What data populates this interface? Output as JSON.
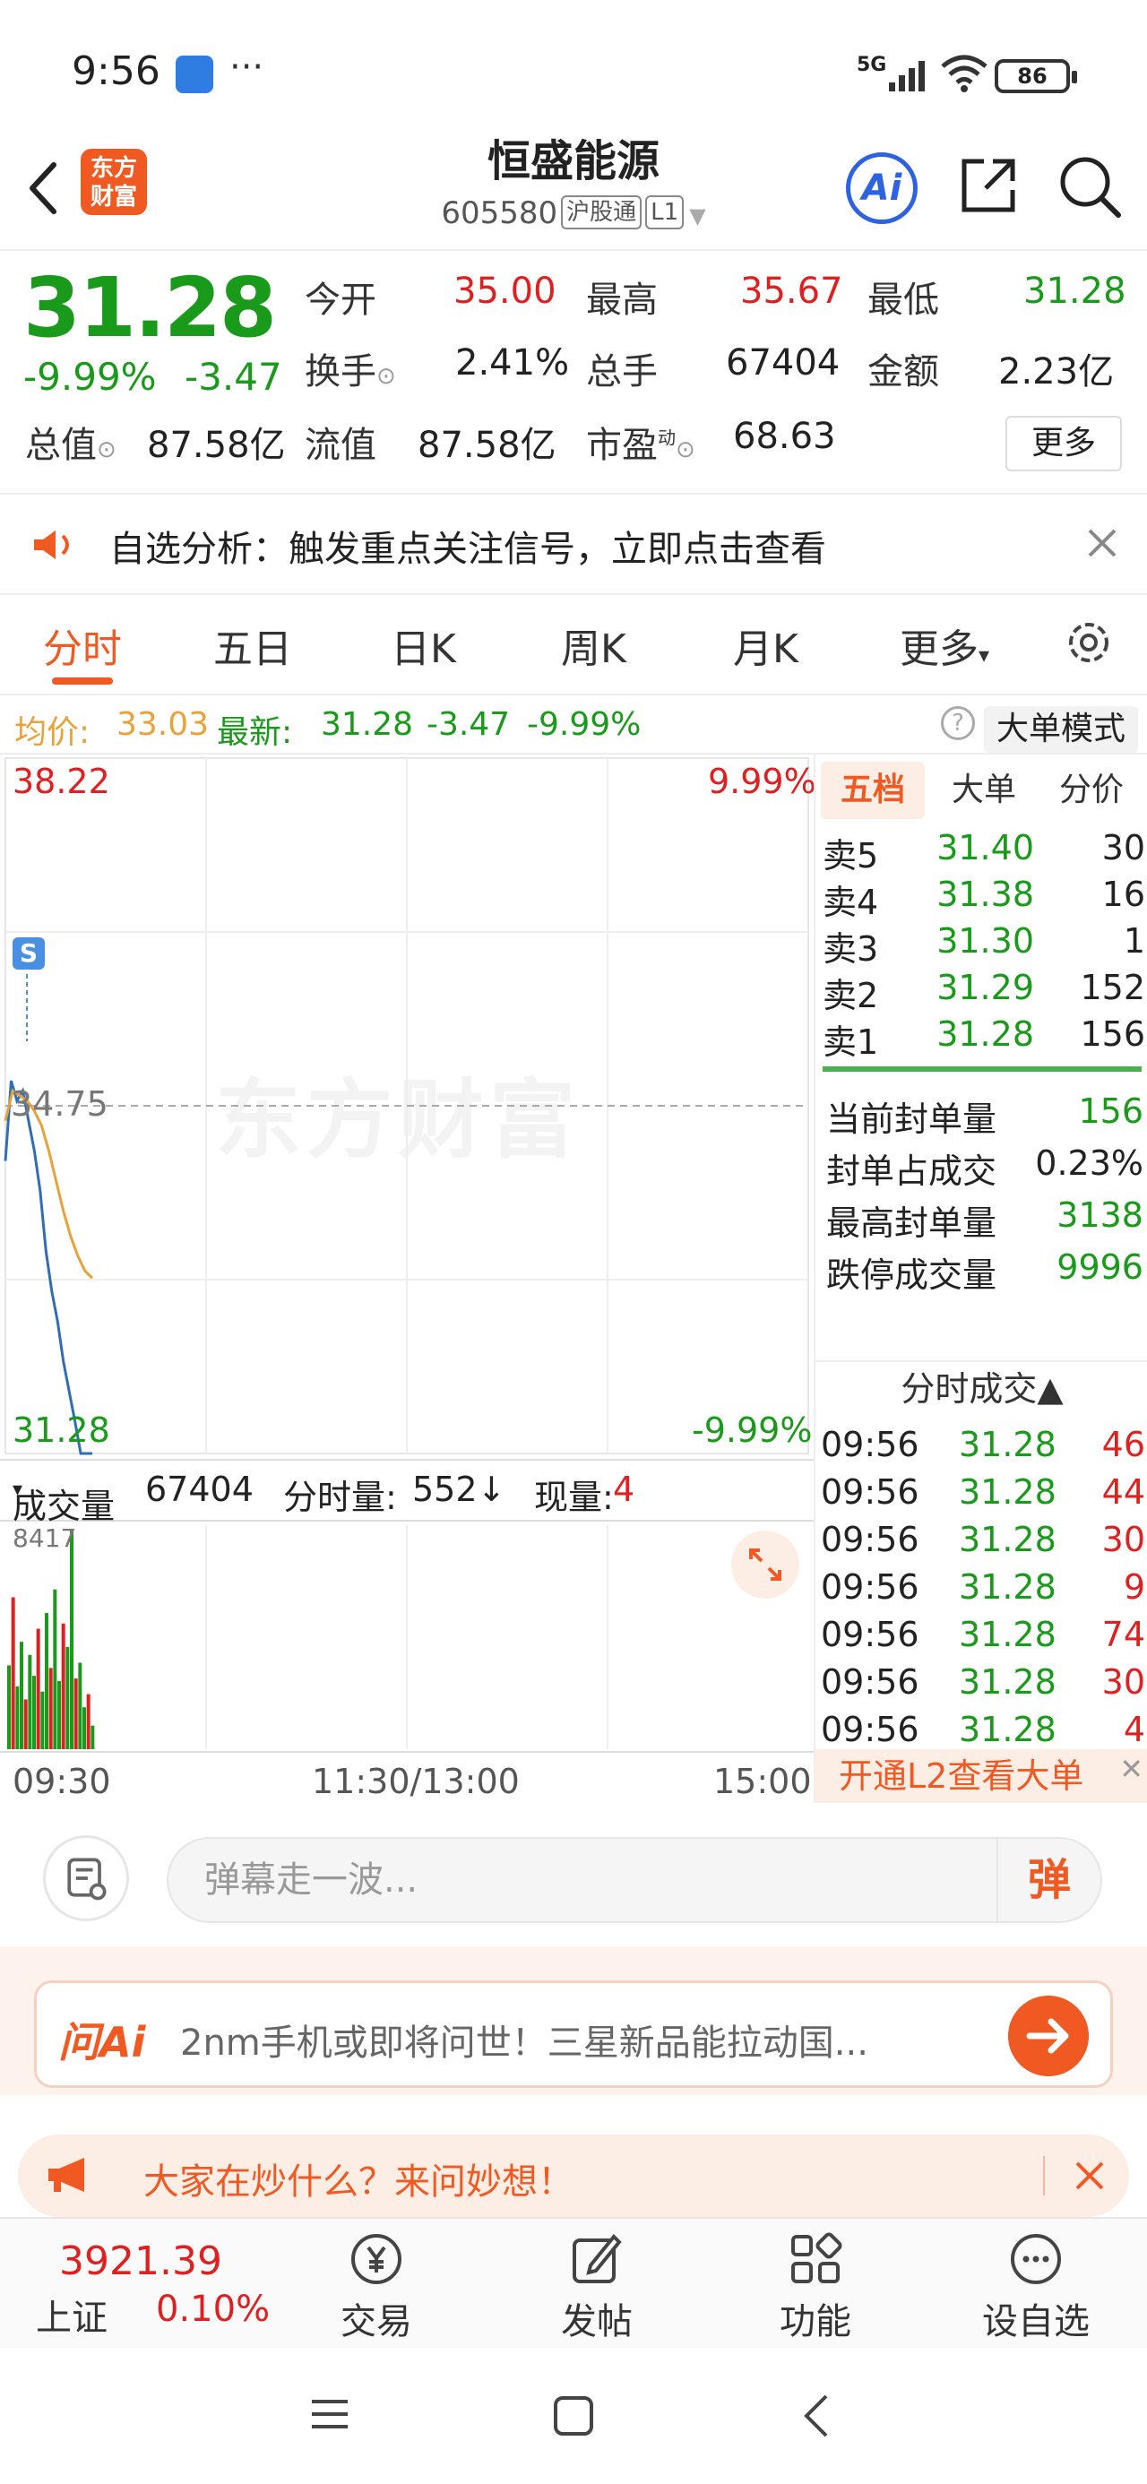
{
  "status_bar": {
    "time": "9:56",
    "more": "···",
    "network": "5G",
    "battery": "86"
  },
  "header": {
    "logo": "东方财富",
    "name": "恒盛能源",
    "code": "605580",
    "tag1": "沪股通",
    "tag2": "L1",
    "ai": "Ai"
  },
  "quote": {
    "price": "31.28",
    "pct": "-9.99%",
    "change": "-3.47",
    "fields": {
      "open_label": "今开",
      "open": "35.00",
      "high_label": "最高",
      "high": "35.67",
      "low_label": "最低",
      "low": "31.28",
      "turnover_label": "换手",
      "turnover": "2.41%",
      "volume_label": "总手",
      "volume": "67404",
      "amount_label": "金额",
      "amount": "2.23亿",
      "mcap_label": "总值",
      "mcap": "87.58亿",
      "float_label": "流值",
      "float": "87.58亿",
      "pe_label": "市盈",
      "pe_sup": "动",
      "pe": "68.63"
    },
    "more": "更多"
  },
  "alert": {
    "text": "自选分析：触发重点关注信号，立即点击查看"
  },
  "tabs": [
    "分时",
    "五日",
    "日K",
    "周K",
    "月K",
    "更多"
  ],
  "infoline": {
    "avg_label": "均价:",
    "avg": "33.03",
    "latest_label": "最新:",
    "latest": "31.28",
    "change": "-3.47",
    "pct": "-9.99%",
    "help": "?",
    "big_mode": "大单模式"
  },
  "chart_labels": {
    "top_price": "38.22",
    "top_pct": "9.99%",
    "mid_price": "34.75",
    "bottom_price": "31.28",
    "bottom_pct": "-9.99%",
    "watermark": "东方财富",
    "s_marker": "S"
  },
  "volume_bar": {
    "select": "成交量",
    "total": "67404",
    "minute_label": "分时量:",
    "minute": "552↓",
    "now_label": "现量:",
    "now": "4",
    "max": "8417"
  },
  "time_axis": [
    "09:30",
    "11:30/13:00",
    "15:00"
  ],
  "chart_data": {
    "type": "line",
    "x_range": [
      "09:30",
      "15:00"
    ],
    "ylim": [
      31.28,
      38.22
    ],
    "reference": 34.75,
    "series": [
      {
        "values": [
          34.2,
          35.0,
          34.8,
          34.9,
          34.6,
          34.3,
          33.9,
          33.3,
          32.9,
          32.6,
          32.2,
          31.9,
          31.6,
          31.28,
          31.28,
          31.28
        ]
      },
      {
        "values": [
          34.6,
          34.9,
          34.85,
          34.8,
          34.7,
          34.55,
          34.3,
          34.0,
          33.7,
          33.45,
          33.25,
          33.1,
          33.03
        ]
      }
    ],
    "volumes": [
      3200,
      5800,
      2400,
      4100,
      1900,
      3600,
      2800,
      4600,
      2200,
      5200,
      3100,
      6100,
      2600,
      4800,
      3900,
      8417,
      2700,
      3300,
      1600,
      2100,
      900
    ]
  },
  "right_panel": {
    "tabs": [
      "五档",
      "大单",
      "分价"
    ],
    "asks": [
      {
        "label": "卖5",
        "price": "31.40",
        "vol": "30"
      },
      {
        "label": "卖4",
        "price": "31.38",
        "vol": "16"
      },
      {
        "label": "卖3",
        "price": "31.30",
        "vol": "1"
      },
      {
        "label": "卖2",
        "price": "31.29",
        "vol": "152"
      },
      {
        "label": "卖1",
        "price": "31.28",
        "vol": "156"
      }
    ],
    "stats": [
      {
        "label": "当前封单量",
        "value": "156"
      },
      {
        "label": "封单占成交",
        "value": "0.23%"
      },
      {
        "label": "最高封单量",
        "value": "3138"
      },
      {
        "label": "跌停成交量",
        "value": "9996"
      }
    ],
    "trades_title": "分时成交▲",
    "trades": [
      {
        "time": "09:56",
        "price": "31.28",
        "vol": "46"
      },
      {
        "time": "09:56",
        "price": "31.28",
        "vol": "44"
      },
      {
        "time": "09:56",
        "price": "31.28",
        "vol": "30"
      },
      {
        "time": "09:56",
        "price": "31.28",
        "vol": "9"
      },
      {
        "time": "09:56",
        "price": "31.28",
        "vol": "74"
      },
      {
        "time": "09:56",
        "price": "31.28",
        "vol": "30"
      },
      {
        "time": "09:56",
        "price": "31.28",
        "vol": "4"
      }
    ],
    "l2": "开通L2查看大单"
  },
  "danmu": {
    "placeholder": "弹幕走一波...",
    "button": "弹"
  },
  "ask": {
    "logo": "问Ai",
    "text": "2nm手机或即将问世！三星新品能拉动国..."
  },
  "hot": {
    "text": "大家在炒什么？来问妙想！"
  },
  "bottom": {
    "index_value": "3921.39",
    "index_name": "上证",
    "index_pct": "0.10%",
    "nav": [
      "交易",
      "发帖",
      "功能",
      "设自选"
    ]
  },
  "colors": {
    "accent": "#f05a22",
    "up": "#e02020",
    "down": "#1a9a1a",
    "price_line": "#2f6db5",
    "avg_line": "#e8a23a"
  }
}
